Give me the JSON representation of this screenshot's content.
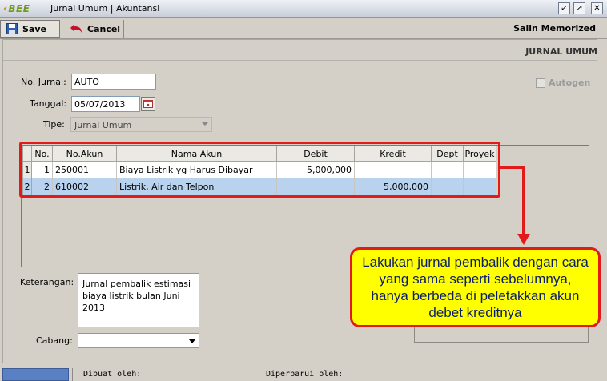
{
  "window": {
    "logo_text": "BEE",
    "title": "Jurnal Umum | Akuntansi"
  },
  "toolbar": {
    "save_label": "Save",
    "cancel_label": "Cancel",
    "salin_label": "Salin Memorized"
  },
  "form": {
    "panel_title": "JURNAL UMUM",
    "no_jurnal_label": "No. Jurnal:",
    "no_jurnal_value": "AUTO",
    "tanggal_label": "Tanggal:",
    "tanggal_value": "05/07/2013",
    "tipe_label": "Tipe:",
    "tipe_value": "Jurnal Umum",
    "autogen_label": "Autogen",
    "keterangan_label": "Keterangan:",
    "keterangan_line1": "Jurnal pembalik estimasi",
    "keterangan_line2": "biaya listrik bulan Juni 2013",
    "cabang_label": "Cabang:",
    "cabang_value": ""
  },
  "grid": {
    "columns": [
      "No.",
      "No.Akun",
      "Nama Akun",
      "Debit",
      "Kredit",
      "Dept",
      "Proyek"
    ],
    "rows": [
      {
        "rownum": "1",
        "no": "1",
        "akun": "250001",
        "nama": "Biaya Listrik yg Harus Dibayar",
        "debit": "5,000,000",
        "kredit": "",
        "dept": "",
        "proyek": ""
      },
      {
        "rownum": "2",
        "no": "2",
        "akun": "610002",
        "nama": "Listrik, Air dan Telpon",
        "debit": "",
        "kredit": "5,000,000",
        "dept": "",
        "proyek": ""
      }
    ]
  },
  "annotation": {
    "callout_text": "Lakukan jurnal pembalik dengan cara yang sama seperti sebelumnya, hanya berbeda di peletakkan akun debet kreditnya",
    "highlight_color": "#e31a1a",
    "callout_bg": "#ffff00"
  },
  "status": {
    "dibuat_label": "Dibuat oleh:",
    "diperbarui_label": "Diperbarui oleh:"
  },
  "icons": {
    "save": "save-disk-icon",
    "cancel": "undo-arrow-icon",
    "calendar": "calendar-icon",
    "minimize": "minimize-icon",
    "restore": "restore-icon",
    "close": "close-icon"
  }
}
